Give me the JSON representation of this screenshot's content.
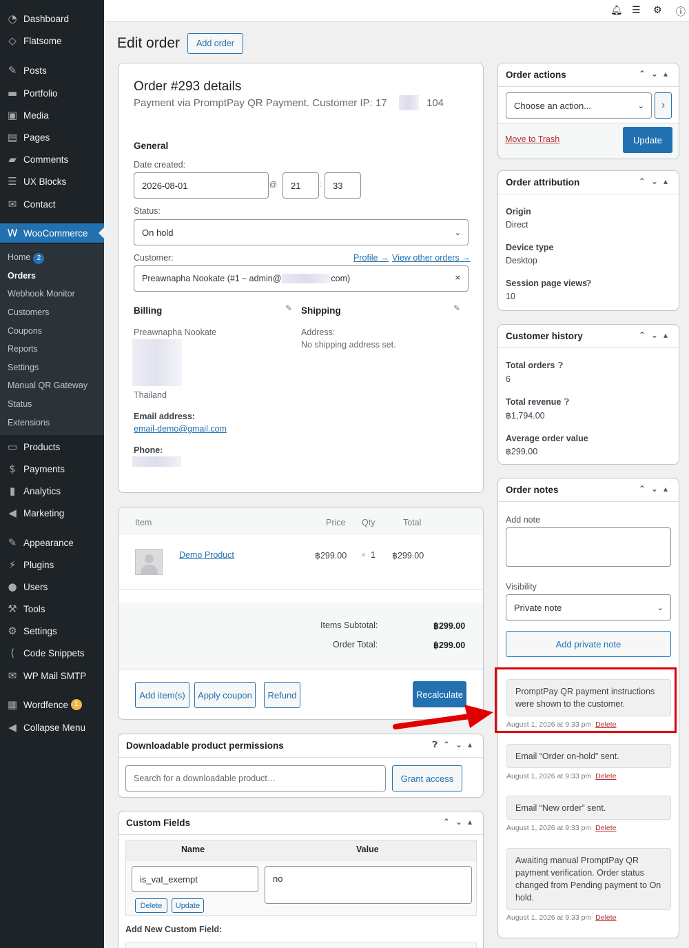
{
  "sidebar": {
    "items": [
      {
        "label": "Dashboard",
        "icon": "dashboard-icon",
        "glyph": "◔"
      },
      {
        "label": "Flatsome",
        "icon": "flatsome-icon",
        "glyph": "◇"
      },
      {
        "label": "Posts",
        "icon": "pin-icon",
        "glyph": "✎"
      },
      {
        "label": "Portfolio",
        "icon": "folder-icon",
        "glyph": "▬"
      },
      {
        "label": "Media",
        "icon": "media-icon",
        "glyph": "▣"
      },
      {
        "label": "Pages",
        "icon": "pages-icon",
        "glyph": "▤"
      },
      {
        "label": "Comments",
        "icon": "comment-icon",
        "glyph": "▰"
      },
      {
        "label": "UX Blocks",
        "icon": "blocks-icon",
        "glyph": "☰"
      },
      {
        "label": "Contact",
        "icon": "mail-icon",
        "glyph": "✉"
      },
      {
        "label": "WooCommerce",
        "icon": "woocommerce-icon",
        "glyph": "W"
      },
      {
        "label": "Products",
        "icon": "products-icon",
        "glyph": "▭"
      },
      {
        "label": "Payments",
        "icon": "payments-icon",
        "glyph": "$"
      },
      {
        "label": "Analytics",
        "icon": "analytics-icon",
        "glyph": "▮"
      },
      {
        "label": "Marketing",
        "icon": "megaphone-icon",
        "glyph": "◀"
      },
      {
        "label": "Appearance",
        "icon": "brush-icon",
        "glyph": "✎"
      },
      {
        "label": "Plugins",
        "icon": "plug-icon",
        "glyph": "⚡"
      },
      {
        "label": "Users",
        "icon": "user-icon",
        "glyph": "●"
      },
      {
        "label": "Tools",
        "icon": "wrench-icon",
        "glyph": "⚒"
      },
      {
        "label": "Settings",
        "icon": "settings-icon",
        "glyph": "⚙"
      },
      {
        "label": "Code Snippets",
        "icon": "code-icon",
        "glyph": "⟨"
      },
      {
        "label": "WP Mail SMTP",
        "icon": "envelope-icon",
        "glyph": "✉"
      },
      {
        "label": "Wordfence",
        "icon": "wordfence-icon",
        "glyph": "▦",
        "badge": "1"
      },
      {
        "label": "Collapse Menu",
        "icon": "collapse-icon",
        "glyph": "◀"
      }
    ],
    "submenu": [
      {
        "label": "Home",
        "badge": "2"
      },
      {
        "label": "Orders"
      },
      {
        "label": "Webhook Monitor"
      },
      {
        "label": "Customers"
      },
      {
        "label": "Coupons"
      },
      {
        "label": "Reports"
      },
      {
        "label": "Settings"
      },
      {
        "label": "Manual QR Gateway"
      },
      {
        "label": "Status"
      },
      {
        "label": "Extensions"
      }
    ]
  },
  "page": {
    "title": "Edit order",
    "add_button": "Add order"
  },
  "order": {
    "title": "Order #293 details",
    "subtitle_a": "Payment via PromptPay QR Payment. Customer IP: 17",
    "subtitle_b": "104",
    "general_label": "General",
    "date_label": "Date created:",
    "date": "2026-08-01",
    "at": "@",
    "hour": "21",
    "colon": ":",
    "minute": "33",
    "status_label": "Status:",
    "status": "On hold",
    "customer_label": "Customer:",
    "profile_link": "Profile →",
    "other_orders_link": "View other orders →",
    "customer_a": "Preawnapha Nookate (#1 – admin@",
    "customer_b": "com)",
    "clear": "×",
    "billing_label": "Billing",
    "billing_name": "Preawnapha Nookate",
    "billing_country": "Thailand",
    "email_label": "Email address:",
    "email": "email-demo@gmail.com",
    "phone_label": "Phone:",
    "shipping_label": "Shipping",
    "address_label": "Address:",
    "no_shipping": "No shipping address set."
  },
  "items": {
    "headers": {
      "item": "Item",
      "price": "Price",
      "qty": "Qty",
      "total": "Total"
    },
    "rows": [
      {
        "name": "Demo Product",
        "price": "฿299.00",
        "qty_x": "×",
        "qty": "1",
        "total": "฿299.00"
      }
    ],
    "subtotal_label": "Items Subtotal:",
    "subtotal": "฿299.00",
    "order_total_label": "Order Total:",
    "order_total": "฿299.00",
    "buttons": {
      "add": "Add item(s)",
      "coupon": "Apply coupon",
      "refund": "Refund",
      "recalc": "Recalculate"
    }
  },
  "downloads": {
    "title": "Downloadable product permissions",
    "placeholder": "Search for a downloadable product…",
    "grant": "Grant access"
  },
  "custom_fields": {
    "title": "Custom Fields",
    "col_name": "Name",
    "col_value": "Value",
    "key": "is_vat_exempt",
    "value": "no",
    "delete": "Delete",
    "update": "Update",
    "add_new": "Add New Custom Field:"
  },
  "order_actions": {
    "title": "Order actions",
    "select": "Choose an action...",
    "go": "›",
    "trash": "Move to Trash",
    "update": "Update"
  },
  "attribution": {
    "title": "Order attribution",
    "rows": [
      {
        "label": "Origin",
        "value": "Direct"
      },
      {
        "label": "Device type",
        "value": "Desktop"
      },
      {
        "label": "Session page views",
        "value": "10"
      }
    ]
  },
  "history": {
    "title": "Customer history",
    "rows": [
      {
        "label": "Total orders",
        "value": "6"
      },
      {
        "label": "Total revenue",
        "value": "฿1,794.00"
      },
      {
        "label": "Average order value",
        "value": "฿299.00"
      }
    ]
  },
  "notes": {
    "title": "Order notes",
    "add_label": "Add note",
    "visibility_label": "Visibility",
    "visibility": "Private note",
    "add_button": "Add private note",
    "list": [
      {
        "text": "PromptPay QR payment instructions were shown to the customer.",
        "meta": "August 1, 2026 at 9:33 pm",
        "delete": "Delete"
      },
      {
        "text": "Email “Order on-hold” sent.",
        "meta": "August 1, 2026 at 9:33 pm",
        "delete": "Delete"
      },
      {
        "text": "Email “New order” sent.",
        "meta": "August 1, 2026 at 9:33 pm",
        "delete": "Delete"
      },
      {
        "text": "Awaiting manual PromptPay QR payment verification. Order status changed from Pending payment to On hold.",
        "meta": "August 1, 2026 at 9:33 pm",
        "delete": "Delete"
      }
    ]
  },
  "colors": {
    "accent": "#2271b1",
    "sidebar": "#1d2327",
    "highlight": "#e00000"
  }
}
